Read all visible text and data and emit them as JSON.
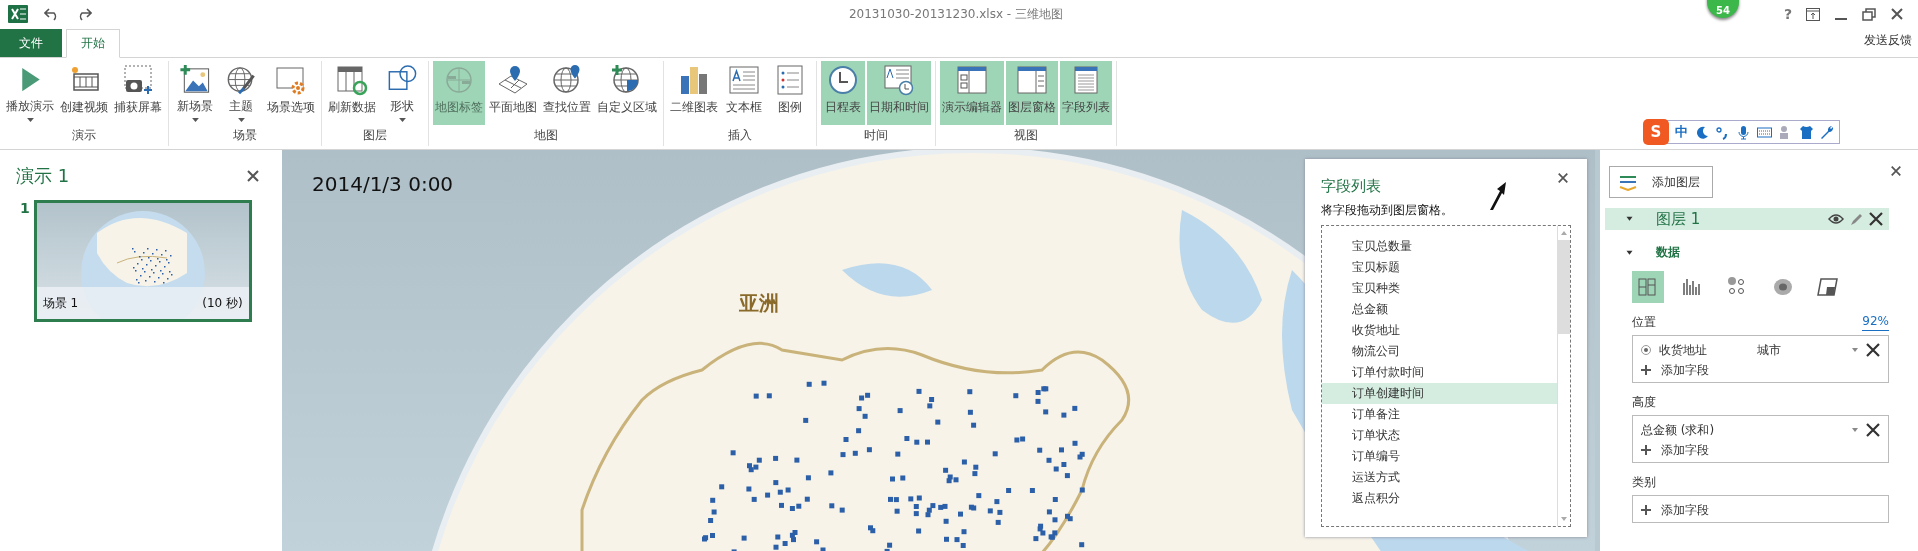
{
  "window": {
    "title": "20131030-20131230.xlsx - 三维地图",
    "help": "?"
  },
  "floating_badge": "54",
  "tabs": [
    {
      "label": "文件",
      "kind": "file",
      "selected": false
    },
    {
      "label": "开始",
      "kind": "normal",
      "selected": true
    }
  ],
  "feedback": "发送反馈",
  "ribbon_groups": [
    {
      "label": "演示",
      "buttons": [
        {
          "label": "播放演示",
          "kind": "play",
          "dropdown": true,
          "selected": false,
          "disabled": false
        },
        {
          "label": "创建视频",
          "kind": "video",
          "dropdown": false,
          "selected": false,
          "disabled": false
        },
        {
          "label": "捕获屏幕",
          "kind": "capture",
          "dropdown": false,
          "selected": false,
          "disabled": false
        }
      ]
    },
    {
      "label": "场景",
      "buttons": [
        {
          "label": "新场景",
          "kind": "newscene",
          "dropdown": true,
          "selected": false,
          "disabled": false
        },
        {
          "label": "主题",
          "kind": "theme",
          "dropdown": true,
          "selected": false,
          "disabled": false
        },
        {
          "label": "场景选项",
          "kind": "sceneopts",
          "dropdown": false,
          "selected": false,
          "disabled": false
        }
      ]
    },
    {
      "label": "图层",
      "buttons": [
        {
          "label": "刷新数据",
          "kind": "refresh",
          "dropdown": false,
          "selected": false,
          "disabled": false
        },
        {
          "label": "形状",
          "kind": "shape",
          "dropdown": true,
          "selected": false,
          "disabled": false
        }
      ]
    },
    {
      "label": "地图",
      "buttons": [
        {
          "label": "地图标签",
          "kind": "maplabels",
          "dropdown": false,
          "selected": true,
          "disabled": true
        },
        {
          "label": "平面地图",
          "kind": "flatmap",
          "dropdown": false,
          "selected": false,
          "disabled": false
        },
        {
          "label": "查找位置",
          "kind": "find",
          "dropdown": false,
          "selected": false,
          "disabled": false
        },
        {
          "label": "自定义区域",
          "kind": "region",
          "dropdown": false,
          "selected": false,
          "disabled": false
        }
      ]
    },
    {
      "label": "插入",
      "buttons": [
        {
          "label": "二维图表",
          "kind": "chart2d",
          "dropdown": false,
          "selected": false,
          "disabled": false
        },
        {
          "label": "文本框",
          "kind": "textbox",
          "dropdown": false,
          "selected": false,
          "disabled": false
        },
        {
          "label": "图例",
          "kind": "legend",
          "dropdown": false,
          "selected": false,
          "disabled": false
        }
      ]
    },
    {
      "label": "时间",
      "buttons": [
        {
          "label": "日程表",
          "kind": "timeline",
          "dropdown": false,
          "selected": true,
          "disabled": false
        },
        {
          "label": "日期和时间",
          "kind": "datetime",
          "dropdown": false,
          "selected": true,
          "disabled": false
        }
      ]
    },
    {
      "label": "视图",
      "buttons": [
        {
          "label": "演示编辑器",
          "kind": "toureditor",
          "dropdown": false,
          "selected": true,
          "disabled": false
        },
        {
          "label": "图层窗格",
          "kind": "layerpane",
          "dropdown": false,
          "selected": true,
          "disabled": false
        },
        {
          "label": "字段列表",
          "kind": "fieldlist",
          "dropdown": false,
          "selected": true,
          "disabled": false
        }
      ]
    }
  ],
  "ime_toolbar": {
    "logo": "S",
    "mode": "中"
  },
  "tour_panel": {
    "title": "演示 1",
    "scenes": [
      {
        "number": "1",
        "name": "场景 1",
        "duration": "(10 秒)",
        "selected": true
      }
    ]
  },
  "map": {
    "timestamp": "2014/1/3 0:00",
    "labels": [
      "亚洲"
    ]
  },
  "field_list": {
    "title": "字段列表",
    "hint": "将字段拖动到图层窗格。",
    "fields": [
      {
        "label": "宝贝总数量",
        "selected": false
      },
      {
        "label": "宝贝标题",
        "selected": false
      },
      {
        "label": "宝贝种类",
        "selected": false
      },
      {
        "label": "总金额",
        "selected": false
      },
      {
        "label": "收货地址",
        "selected": false
      },
      {
        "label": "物流公司",
        "selected": false
      },
      {
        "label": "订单付款时间",
        "selected": false
      },
      {
        "label": "订单创建时间",
        "selected": true
      },
      {
        "label": "订单备注",
        "selected": false
      },
      {
        "label": "订单状态",
        "selected": false
      },
      {
        "label": "订单编号",
        "selected": false
      },
      {
        "label": "运送方式",
        "selected": false
      },
      {
        "label": "返点积分",
        "selected": false
      }
    ]
  },
  "layer_pane": {
    "add_layer": "添加图层",
    "layers": [
      {
        "name": "图层 1",
        "expanded": true,
        "section": {
          "title": "数据",
          "expanded": true,
          "viz_types": [
            {
              "kind": "stacked",
              "selected": true
            },
            {
              "kind": "clustered",
              "selected": false
            },
            {
              "kind": "bubble",
              "selected": false
            },
            {
              "kind": "heatmap",
              "selected": false
            },
            {
              "kind": "region",
              "selected": false
            }
          ],
          "wells": [
            {
              "label": "位置",
              "extra": "92%",
              "entries": [
                {
                  "kind": "geo",
                  "checked": true,
                  "field": "收货地址",
                  "type": "城市"
                }
              ],
              "add": "添加字段"
            },
            {
              "label": "高度",
              "entries": [
                {
                  "kind": "value",
                  "field": "总金额 (求和)"
                }
              ],
              "add": "添加字段"
            },
            {
              "label": "类别",
              "add": "添加字段"
            }
          ]
        }
      }
    ]
  }
}
